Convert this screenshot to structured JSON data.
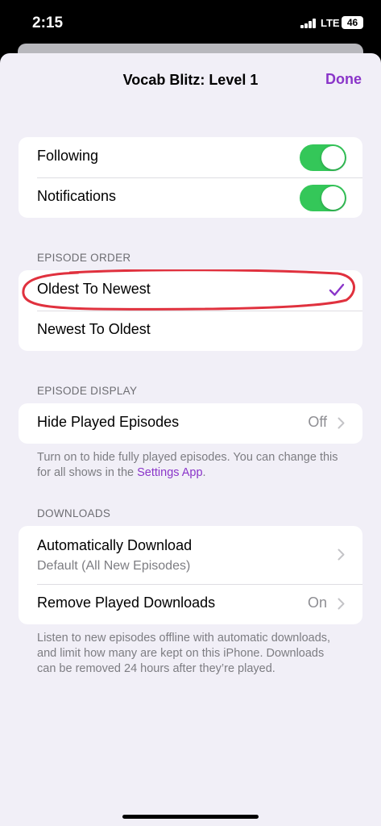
{
  "status_bar": {
    "time": "2:15",
    "network": "LTE",
    "battery": "46"
  },
  "nav": {
    "title": "Vocab Blitz: Level 1",
    "done_label": "Done"
  },
  "toggles": [
    {
      "label": "Following",
      "on": true
    },
    {
      "label": "Notifications",
      "on": true
    }
  ],
  "episode_order": {
    "header": "EPISODE ORDER",
    "options": [
      {
        "label": "Oldest To Newest",
        "selected": true
      },
      {
        "label": "Newest To Oldest",
        "selected": false
      }
    ]
  },
  "episode_display": {
    "header": "EPISODE DISPLAY",
    "hide_played": {
      "label": "Hide Played Episodes",
      "value": "Off"
    },
    "footer_text": "Turn on to hide fully played episodes. You can change this for all shows in the",
    "footer_link": "Settings App",
    "footer_end": "."
  },
  "downloads": {
    "header": "DOWNLOADS",
    "auto_download": {
      "label": "Automatically Download",
      "subtitle": "Default (All New Episodes)"
    },
    "remove_played": {
      "label": "Remove Played Downloads",
      "value": "On"
    },
    "footer_text": "Listen to new episodes offline with automatic downloads, and limit how many are kept on this iPhone. Downloads can be removed 24 hours after they’re played."
  },
  "colors": {
    "accent": "#8a35c9",
    "toggle_on": "#34c759",
    "annotation": "#e0313e",
    "background": "#f1eff7"
  }
}
